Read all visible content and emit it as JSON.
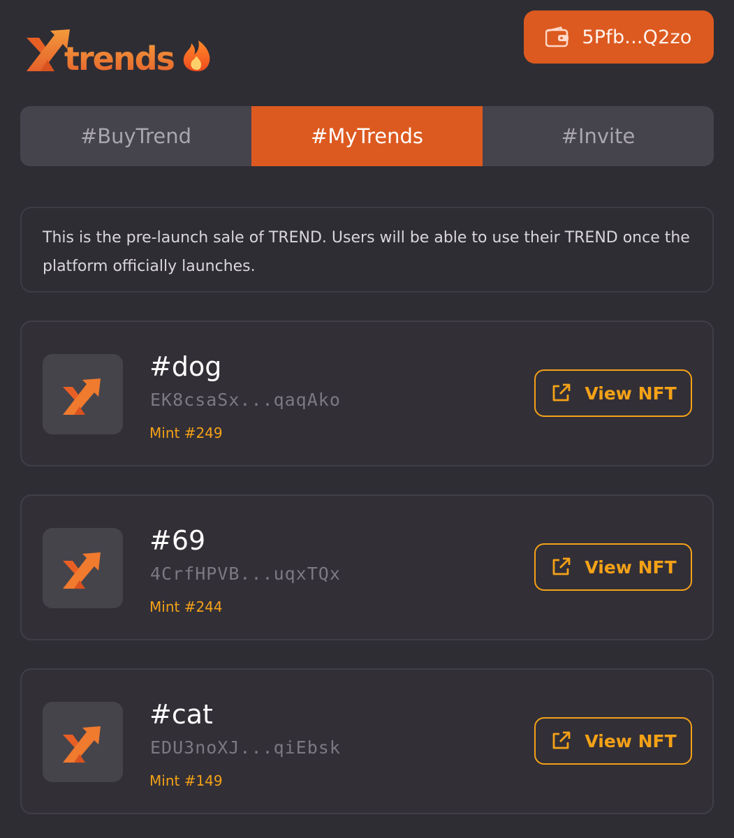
{
  "brand": {
    "logo_text": "Xtrends",
    "accent_color": "#dc5a20",
    "highlight_color": "#f5a217"
  },
  "wallet": {
    "label": "5Pfb...Q2zo",
    "icon": "wallet-icon"
  },
  "tabs": [
    {
      "label": "#BuyTrend",
      "active": false
    },
    {
      "label": "#MyTrends",
      "active": true
    },
    {
      "label": "#Invite",
      "active": false
    }
  ],
  "notice": {
    "text": "This is the pre-launch sale of TREND. Users will be able to use their TREND once the platform officially launches."
  },
  "nfts": [
    {
      "name": "#dog",
      "address": "EK8csaSx...qaqAko",
      "mint": "Mint #249",
      "button_label": "View NFT",
      "icon": "external-link-icon"
    },
    {
      "name": "#69",
      "address": "4CrfHPVB...uqxTQx",
      "mint": "Mint #244",
      "button_label": "View NFT",
      "icon": "external-link-icon"
    },
    {
      "name": "#cat",
      "address": "EDU3noXJ...qiEbsk",
      "mint": "Mint #149",
      "button_label": "View NFT",
      "icon": "external-link-icon"
    }
  ]
}
